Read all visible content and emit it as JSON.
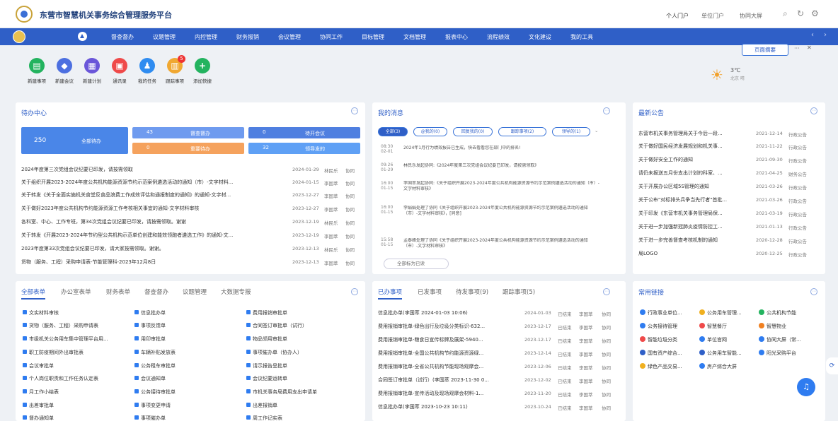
{
  "header": {
    "title": "东营市智慧机关事务综合管理服务平台",
    "links": [
      "个人门户",
      "单位门户",
      "协同大屏"
    ]
  },
  "nav": [
    "督查督办",
    "议题管理",
    "内控管理",
    "财务报销",
    "会议管理",
    "协同工作",
    "目标管理",
    "文档管理",
    "报表中心",
    "流程绩效",
    "文化建设",
    "我的工具"
  ],
  "quick": [
    {
      "label": "新建事项",
      "color": "#23b35f",
      "glyph": "▤"
    },
    {
      "label": "新建会议",
      "color": "#4c6fe0",
      "glyph": "◆"
    },
    {
      "label": "新建计划",
      "color": "#6a56d9",
      "glyph": "▦"
    },
    {
      "label": "通讯录",
      "color": "#ef4a4a",
      "glyph": "▣"
    },
    {
      "label": "我的任务",
      "color": "#2f8cf0",
      "glyph": "♟"
    },
    {
      "label": "跟踪事项",
      "color": "#f0a832",
      "glyph": "▥",
      "badge": "5"
    },
    {
      "label": "添加快捷",
      "color": "#23b35f",
      "glyph": "+"
    }
  ],
  "summary_button": "页面摘要",
  "weather": {
    "temp": "3℃",
    "city": "北京 晴"
  },
  "todo": {
    "title": "待办中心",
    "tiles": {
      "all_count": "250",
      "all_label": "全部待办",
      "c1": "43",
      "l1": "督查督办",
      "c2": "0",
      "l2": "待开会议",
      "c3": "0",
      "l3": "重要待办",
      "c4": "32",
      "l4": "领导发的"
    },
    "rows": [
      {
        "t": "2024年度第三次党组会议纪要已印发，请按需领取",
        "d": "2024-01-29",
        "u": "林民乐",
        "s": "协同"
      },
      {
        "t": "关于组织开展2023-2024年度公共机构能源资源节约示范案例遴选活动的通知（市）-文字材料...",
        "d": "2024-01-15",
        "u": "李国萃",
        "s": "协同"
      },
      {
        "t": "关于转发《关于全面实施机关食堂反食品浪费工作成效评估和通报制度的通知》的通知-文字材...",
        "d": "2023-12-27",
        "u": "李国萃",
        "s": "协同"
      },
      {
        "t": "关于做好2023年度公共机构节约能源资源工作考核相关事宜的通知-文字材料审核",
        "d": "2023-12-27",
        "u": "李国萃",
        "s": "协同"
      },
      {
        "t": "各科室、中心、工作专班，第34次党组会议纪要已印发，请按需领取。谢谢",
        "d": "2023-12-19",
        "u": "林民乐",
        "s": "协同"
      },
      {
        "t": "关于转发《开展2023-2024年节约型公共机构示范单位创建和能效领跑者遴选工作》的通知-文...",
        "d": "2023-12-19",
        "u": "李国萃",
        "s": "协同"
      },
      {
        "t": "2023年度第33次党组会议纪要已印发，请大家按需领取。谢谢。",
        "d": "2023-12-13",
        "u": "林民乐",
        "s": "协同"
      },
      {
        "t": "货物（服务、工程）采购申请表-节能管理科-2023年12月8日",
        "d": "2023-12-13",
        "u": "李国萃",
        "s": "协同"
      }
    ]
  },
  "messages": {
    "title": "我的消息",
    "filters": [
      "全部(3)",
      "@我的(0)",
      "回复我的(0)",
      "跟踪事项(2)",
      "领导的(1)"
    ],
    "items": [
      {
        "time": "08:30",
        "date": "02-01",
        "text": "2024年1月行为绩效报告已生成，快去看看您在部门中的排名!"
      },
      {
        "time": "09:26",
        "date": "01-29",
        "text": "林民乐发起协同:《2024年度第三次党组会议纪要已印发，请按需领取》"
      },
      {
        "time": "16:00",
        "date": "01-15",
        "text": "李国萃发起协同:《关于组织开展2023-2024年度公共机构能源资源节约示范案例遴选活动的通知（市）-文字材料审核》"
      },
      {
        "time": "16:00",
        "date": "01-15",
        "text": "李娟娟处理了协同《关于组织开展2023-2024年度公共机构能源资源节约示范案例遴选活动的通知（市）-文字材料审核》，[同意]"
      },
      {
        "time": "15:58",
        "date": "01-15",
        "text": "孟泰峰处理了协同《关于组织开展2023-2024年度公共机构能源资源节约示范案例遴选活动的通知（市）-文字材料审核》"
      }
    ],
    "mark_all": "全部标为已读"
  },
  "notice": {
    "title": "最新公告",
    "rows": [
      {
        "t": "东营市机关事务管理局关于今后一段...",
        "d": "2021-12-14",
        "c": "行政公告"
      },
      {
        "t": "关于做好国民经济发展规划和机关事...",
        "d": "2021-11-22",
        "c": "行政公告"
      },
      {
        "t": "关于做好安全工作的通知",
        "d": "2021-09-30",
        "c": "行政公告"
      },
      {
        "t": "请仍未报送五月份支出计划的科室、...",
        "d": "2021-04-25",
        "c": "财务公告"
      },
      {
        "t": "关于开展办公区域5S管理的通知",
        "d": "2021-03-26",
        "c": "行政公告"
      },
      {
        "t": "关于公布\"对标排头兵争当先行者\"首批...",
        "d": "2021-03-26",
        "c": "行政公告"
      },
      {
        "t": "关于印发《东营市机关事务管理局保...",
        "d": "2021-03-19",
        "c": "行政公告"
      },
      {
        "t": "关于进一步加强新冠肺炎疫情防控工...",
        "d": "2021-01-13",
        "c": "行政公告"
      },
      {
        "t": "关于进一步完善督查考核机制的通知",
        "d": "2020-12-28",
        "c": "行政公告"
      },
      {
        "t": "局LOGO",
        "d": "2020-12-25",
        "c": "行政公告"
      }
    ]
  },
  "forms": {
    "tabs": [
      "全部表单",
      "办公室表单",
      "财务表单",
      "督查督办",
      "议题管理",
      "大数据专报"
    ],
    "cols": [
      [
        "文实材料审核",
        "货物（服务、工程）采购申请表",
        "市级机关公务用车集中管理平台用...",
        "职工防疫期间外出审批表",
        "会议审批单",
        "个人岗位职责和工作任务认定表",
        "月工作小结表",
        "出差审批单",
        "督办通知单"
      ],
      [
        "信息批办单",
        "事项反馈单",
        "用印审批单",
        "车辆补贴发放表",
        "公务租车审批单",
        "会议通知单",
        "公务接待审批单",
        "事项变更申请",
        "事项催办单"
      ],
      [
        "费用报销审批单",
        "合同签订审批单（试行）",
        "物品领用审批单",
        "事项催办单（协办人）",
        "请示报告呈批单",
        "会议纪要运转单",
        "市机关事务局费用支出申请单",
        "出差报销单",
        "周工作记实表"
      ]
    ]
  },
  "done": {
    "tabs": [
      "已办事项",
      "已发事项",
      "待发事项(9)",
      "跟踪事项(5)"
    ],
    "rows": [
      {
        "t": "信息批办单(李国萃 2024-01-03 10:06)",
        "d": "2024-01-03",
        "s": "已结束",
        "u": "李国萃",
        "k": "协同"
      },
      {
        "t": "费用报销审批单-绿色出行及垃圾分类标识-632...",
        "d": "2023-12-17",
        "s": "已结束",
        "u": "李国萃",
        "k": "协同"
      },
      {
        "t": "费用报销审批单-粮食日宣传标牌及展架-5940...",
        "d": "2023-12-17",
        "s": "已结束",
        "u": "李国萃",
        "k": "协同"
      },
      {
        "t": "费用报销审批单-全国公共机构节约能源资源绿...",
        "d": "2023-12-14",
        "s": "已结束",
        "u": "李国萃",
        "k": "协同"
      },
      {
        "t": "费用报销审批单-全省公共机构节能现场观摩会...",
        "d": "2023-12-06",
        "s": "已结束",
        "u": "李国萃",
        "k": "协同"
      },
      {
        "t": "合同签订审批单（试行）(李国萃 2023-11-30 0...",
        "d": "2023-12-02",
        "s": "已结束",
        "u": "李国萃",
        "k": "协同"
      },
      {
        "t": "费用报销审批单-宣传活动及现场观摩会材料-1...",
        "d": "2023-11-20",
        "s": "已结束",
        "u": "李国萃",
        "k": "协同"
      },
      {
        "t": "信息批办单(李国萃 2023-10-23 10:11)",
        "d": "2023-10-24",
        "s": "已结束",
        "u": "李国萃",
        "k": "协同"
      }
    ]
  },
  "links": {
    "title": "常用链接",
    "items": [
      {
        "n": "行政事业单位...",
        "c": "#2f7cf0"
      },
      {
        "n": "公务用车管理...",
        "c": "#f0b020"
      },
      {
        "n": "公共机构节能",
        "c": "#23b35f"
      },
      {
        "n": "公务接待管理",
        "c": "#2f7cf0"
      },
      {
        "n": "智慧餐厅",
        "c": "#ef4a4a"
      },
      {
        "n": "智慧物业",
        "c": "#f08020"
      },
      {
        "n": "智能垃圾分类",
        "c": "#ef4a4a"
      },
      {
        "n": "单位官网",
        "c": "#2f7cf0"
      },
      {
        "n": "协同大屏（常...",
        "c": "#2f7cf0"
      },
      {
        "n": "国有资产综合...",
        "c": "#2f5fc7"
      },
      {
        "n": "公务用车智能...",
        "c": "#2f5fc7"
      },
      {
        "n": "阳光采购平台",
        "c": "#2f7cf0"
      },
      {
        "n": "绿色产品交易...",
        "c": "#f0b020"
      },
      {
        "n": "房产综合大屏",
        "c": "#2f7cf0"
      }
    ]
  }
}
